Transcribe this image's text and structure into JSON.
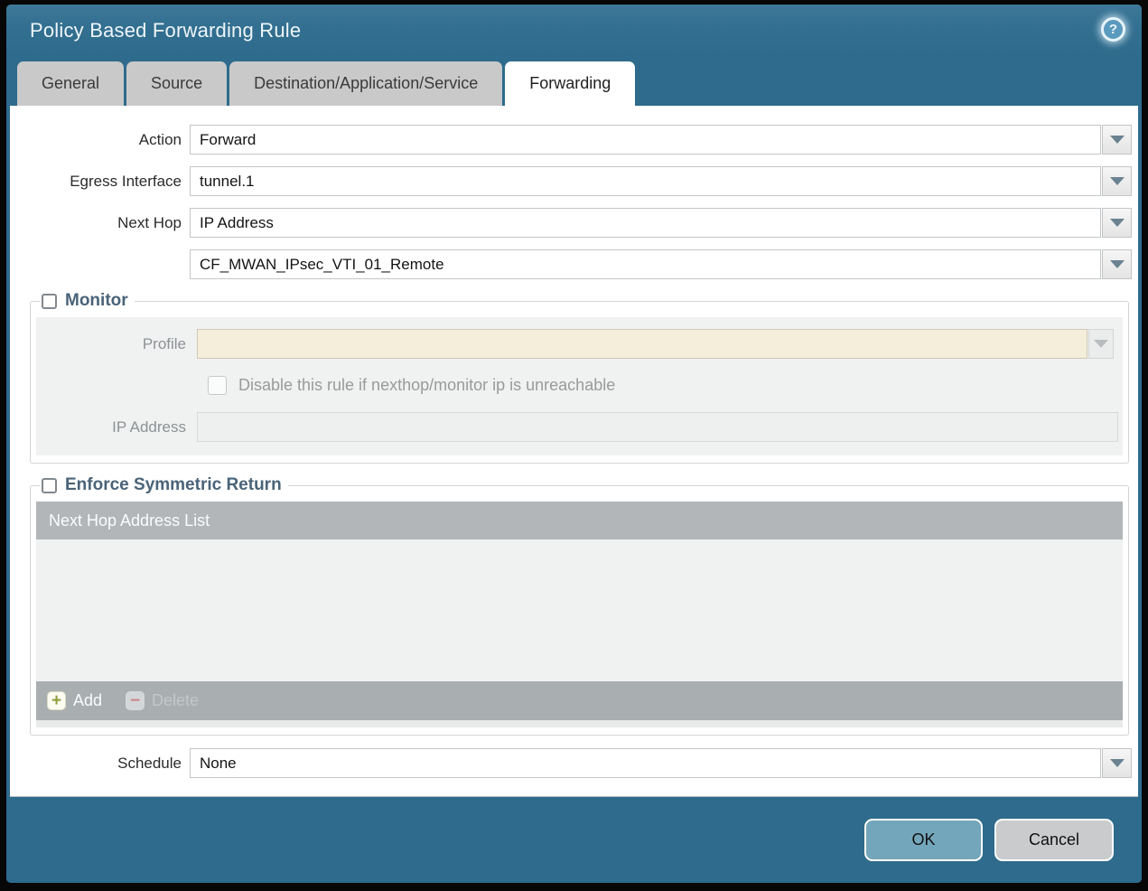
{
  "dialog": {
    "title": "Policy Based Forwarding Rule",
    "help_glyph": "?"
  },
  "tabs": [
    {
      "label": "General",
      "active": false
    },
    {
      "label": "Source",
      "active": false
    },
    {
      "label": "Destination/Application/Service",
      "active": false
    },
    {
      "label": "Forwarding",
      "active": true
    }
  ],
  "form": {
    "action": {
      "label": "Action",
      "value": "Forward"
    },
    "egress_interface": {
      "label": "Egress Interface",
      "value": "tunnel.1"
    },
    "next_hop": {
      "label": "Next Hop",
      "value": "IP Address"
    },
    "next_hop_address": {
      "value": "CF_MWAN_IPsec_VTI_01_Remote"
    },
    "schedule": {
      "label": "Schedule",
      "value": "None"
    }
  },
  "monitor": {
    "legend": "Monitor",
    "checked": false,
    "enabled": false,
    "profile": {
      "label": "Profile",
      "value": ""
    },
    "disable_rule_checkbox": {
      "label": "Disable this rule if nexthop/monitor ip is unreachable",
      "checked": false
    },
    "ip_address": {
      "label": "IP Address",
      "value": ""
    }
  },
  "enforce_symmetric_return": {
    "legend": "Enforce Symmetric Return",
    "checked": false,
    "table": {
      "header": "Next Hop Address List",
      "rows": [],
      "add_label": "Add",
      "delete_label": "Delete",
      "add_icon_glyph": "+",
      "delete_icon_glyph": "−",
      "delete_enabled": false
    }
  },
  "footer": {
    "ok_label": "OK",
    "cancel_label": "Cancel"
  },
  "colors": {
    "frame": "#070707",
    "teal_background": "#2e6b8c",
    "active_tab": "#ffffff",
    "inactive_tab": "#c9c9c9",
    "legend_text": "#4a6378",
    "disabled_field_cream": "#f5eeda",
    "panel_gray": "#f0f1f1",
    "table_header_gray": "#b2b6b9",
    "table_footer_gray": "#a9aeb1",
    "ok_button": "#74a6bb",
    "cancel_button": "#c9cbcd",
    "add_plus_green": "#8fa03b",
    "delete_minus_red": "#cb8585"
  }
}
